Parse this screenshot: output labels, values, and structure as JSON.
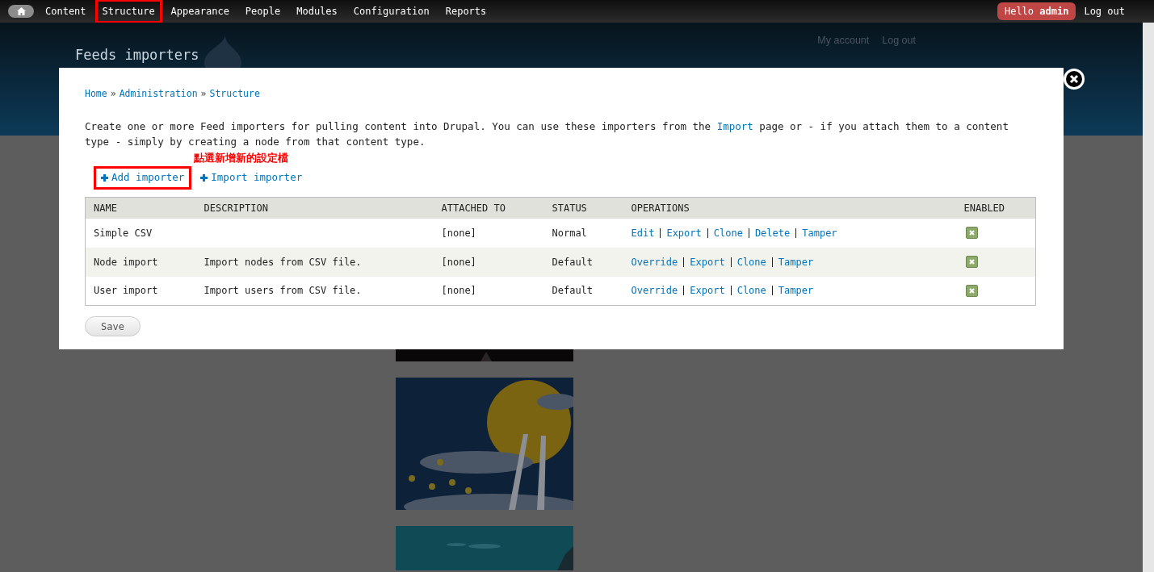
{
  "toolbar": {
    "menu": [
      {
        "label": "Content",
        "highlighted": false
      },
      {
        "label": "Structure",
        "highlighted": true
      },
      {
        "label": "Appearance",
        "highlighted": false
      },
      {
        "label": "People",
        "highlighted": false
      },
      {
        "label": "Modules",
        "highlighted": false
      },
      {
        "label": "Configuration",
        "highlighted": false
      },
      {
        "label": "Reports",
        "highlighted": false
      }
    ],
    "greeting": "Hello",
    "user": "admin",
    "logout": "Log out"
  },
  "header": {
    "site_name": "Feeds importers",
    "links": [
      "My account",
      "Log out"
    ]
  },
  "modal": {
    "breadcrumb": [
      "Home",
      "Administration",
      "Structure"
    ],
    "breadcrumb_separator": "»",
    "description": {
      "before": "Create one or more Feed importers for pulling content into Drupal. You can use these importers from the ",
      "link": "Import",
      "after": " page or - if you attach them to a content type - simply by creating a node from that content type."
    },
    "annotation": "點選新增新的設定檔",
    "actions": [
      {
        "label": "Add importer",
        "highlighted": true
      },
      {
        "label": "Import importer",
        "highlighted": false
      }
    ],
    "table": {
      "columns": [
        "NAME",
        "DESCRIPTION",
        "ATTACHED TO",
        "STATUS",
        "OPERATIONS",
        "ENABLED"
      ],
      "rows": [
        {
          "name": "Simple CSV",
          "description": "",
          "attached_to": "[none]",
          "status": "Normal",
          "operations": [
            "Edit",
            "Export",
            "Clone",
            "Delete",
            "Tamper"
          ],
          "enabled": true
        },
        {
          "name": "Node import",
          "description": "Import nodes from CSV file.",
          "attached_to": "[none]",
          "status": "Default",
          "operations": [
            "Override",
            "Export",
            "Clone",
            "Tamper"
          ],
          "enabled": true
        },
        {
          "name": "User import",
          "description": "Import users from CSV file.",
          "attached_to": "[none]",
          "status": "Default",
          "operations": [
            "Override",
            "Export",
            "Clone",
            "Tamper"
          ],
          "enabled": true
        }
      ]
    },
    "save": "Save"
  }
}
